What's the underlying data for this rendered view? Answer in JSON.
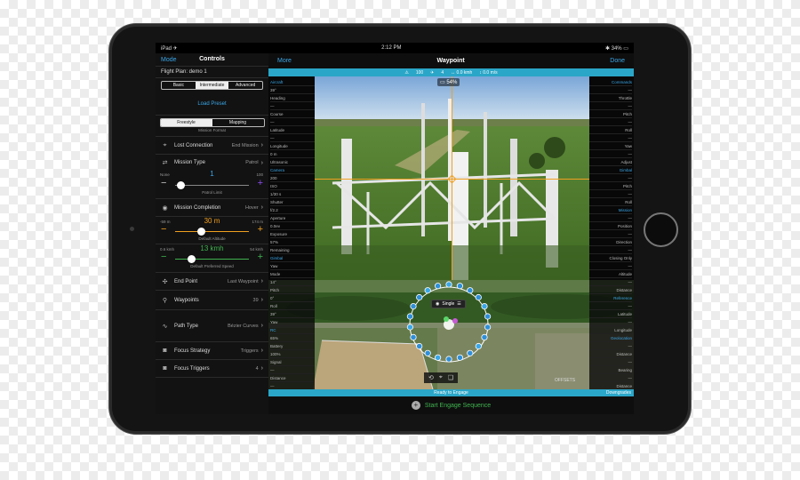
{
  "status": {
    "left": "iPad ✈",
    "time": "2:12 PM",
    "right": "✱ 34% ▭"
  },
  "left_panel": {
    "mode_label": "Mode",
    "title": "Controls",
    "flight_plan": "Flight Plan: demo 1",
    "skill_tabs": [
      "Basic",
      "Intermediate",
      "Advanced"
    ],
    "skill_selected": 1,
    "load_preset": "Load Preset",
    "mission_format_tabs": [
      "Freestyle",
      "Mapping"
    ],
    "mission_format_selected": 0,
    "mission_format_caption": "Mission Format",
    "lost_connection": {
      "label": "Lost Connection",
      "value": "End Mission"
    },
    "mission_type": {
      "label": "Mission Type",
      "value": "Patrol"
    },
    "patrol_limit": {
      "value": "1",
      "min": "None",
      "max": "100",
      "caption": "Patrol Limit",
      "level": 0.08
    },
    "mission_completion": {
      "label": "Mission Completion",
      "value": "Hover"
    },
    "altitude": {
      "value": "30 m",
      "min": "-59 m",
      "max": "174 m",
      "caption": "Default Altitude",
      "level": 0.35
    },
    "speed": {
      "value": "13 kmh",
      "min": "0.6 kmh",
      "max": "54 kmh",
      "caption": "Default Preferred Speed",
      "level": 0.22
    },
    "end_point": {
      "label": "End Point",
      "value": "Last Waypoint"
    },
    "waypoints": {
      "label": "Waypoints",
      "value": "39"
    },
    "path_type": {
      "label": "Path Type",
      "value": "Bézier Curves"
    },
    "focus_strategy": {
      "label": "Focus Strategy",
      "value": "Triggers"
    },
    "focus_triggers": {
      "label": "Focus Triggers",
      "value": "4"
    }
  },
  "topbar": {
    "more": "More",
    "title": "Waypoint",
    "done": "Done"
  },
  "infobar": {
    "battery": "100",
    "sats": "4",
    "hspeed": "↔ 0.0 kmh",
    "vspeed": "↕ 0.0 m/s"
  },
  "battery_overlay": "54%",
  "telemetry_left": [
    {
      "text": "Aircraft",
      "head": true
    },
    {
      "text": "39°"
    },
    {
      "text": "Heading"
    },
    {
      "text": "—"
    },
    {
      "text": "Course"
    },
    {
      "text": "—"
    },
    {
      "text": "Latitude"
    },
    {
      "text": "—"
    },
    {
      "text": "Longitude"
    },
    {
      "text": "0 m"
    },
    {
      "text": "Ultrasonic"
    },
    {
      "text": "Camera",
      "head": true
    },
    {
      "text": "200"
    },
    {
      "text": "ISO"
    },
    {
      "text": "1/30 s"
    },
    {
      "text": "Shutter"
    },
    {
      "text": "f/2.2"
    },
    {
      "text": "Aperture"
    },
    {
      "text": "0.0ev"
    },
    {
      "text": "Exposure"
    },
    {
      "text": "57%"
    },
    {
      "text": "Remaining"
    },
    {
      "text": "Gimbal",
      "head": true
    },
    {
      "text": "Yaw"
    },
    {
      "text": "Mode"
    },
    {
      "text": "14°"
    },
    {
      "text": "Pitch"
    },
    {
      "text": "0°"
    },
    {
      "text": "Roll"
    },
    {
      "text": "39°"
    },
    {
      "text": "Yaw"
    },
    {
      "text": "RC",
      "head": true
    },
    {
      "text": "65%"
    },
    {
      "text": "Battery"
    },
    {
      "text": "100%"
    },
    {
      "text": "Signal"
    },
    {
      "text": "—"
    },
    {
      "text": "Distance"
    },
    {
      "text": "—"
    },
    {
      "text": "Course"
    },
    {
      "text": "—"
    },
    {
      "text": "Speed"
    }
  ],
  "telemetry_right": [
    {
      "text": "Commands",
      "head": true
    },
    {
      "text": "—"
    },
    {
      "text": "Throttle"
    },
    {
      "text": "—"
    },
    {
      "text": "Pitch"
    },
    {
      "text": "—"
    },
    {
      "text": "Roll"
    },
    {
      "text": "—"
    },
    {
      "text": "Yaw"
    },
    {
      "text": "—"
    },
    {
      "text": "Adjust"
    },
    {
      "text": "Gimbal",
      "head": true
    },
    {
      "text": "—"
    },
    {
      "text": "Pitch"
    },
    {
      "text": "—"
    },
    {
      "text": "Roll"
    },
    {
      "text": "Mission",
      "head": true
    },
    {
      "text": "—"
    },
    {
      "text": "Position"
    },
    {
      "text": "—"
    },
    {
      "text": "Direction"
    },
    {
      "text": "—"
    },
    {
      "text": "Closing Only"
    },
    {
      "text": "—"
    },
    {
      "text": "Altitude"
    },
    {
      "text": "—"
    },
    {
      "text": "Distance"
    },
    {
      "text": "Reference",
      "head": true
    },
    {
      "text": "—"
    },
    {
      "text": "Latitude"
    },
    {
      "text": "—"
    },
    {
      "text": "Longitude"
    },
    {
      "text": "Geolocation",
      "head": true
    },
    {
      "text": "—"
    },
    {
      "text": "Distance"
    },
    {
      "text": "—"
    },
    {
      "text": "Bearing"
    },
    {
      "text": "—"
    },
    {
      "text": "Distance"
    },
    {
      "text": "—"
    },
    {
      "text": "Bearing"
    }
  ],
  "single_label": "Single",
  "offsets_label": "OFFSETS",
  "ready_label": "Ready to Engage",
  "downgrades_label": "Downgrades",
  "engage_label": "Start Engage Sequence",
  "colors": {
    "accent": "#3aa7e8",
    "orange": "#f0a020",
    "green": "#3fb34f",
    "bar": "#2aa6c8"
  }
}
